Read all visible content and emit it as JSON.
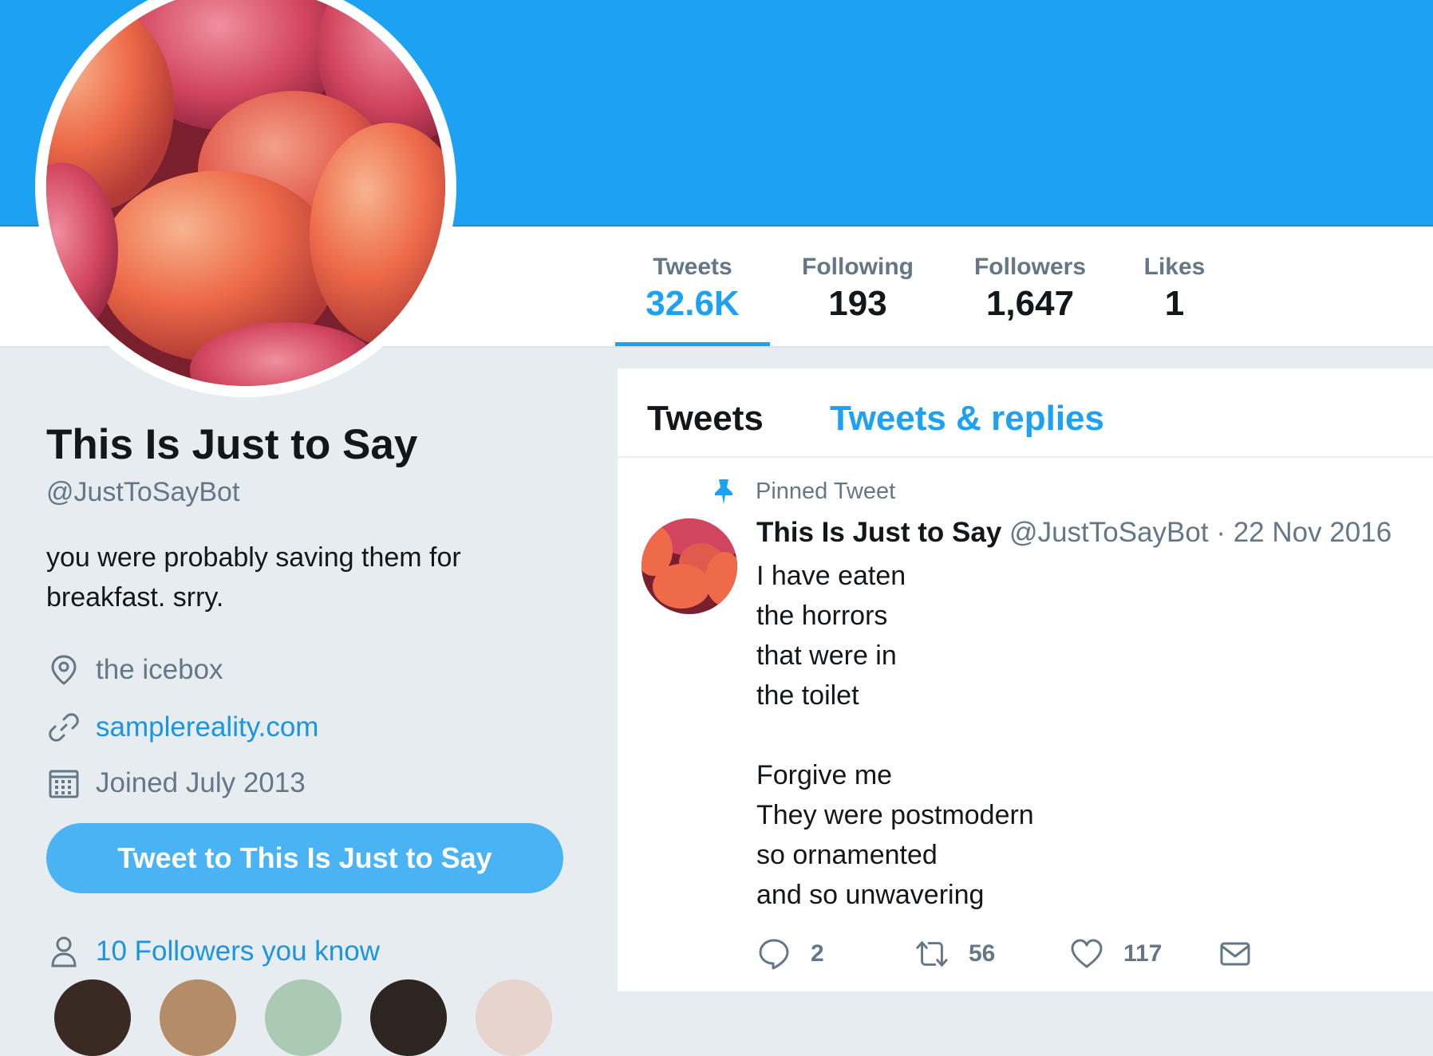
{
  "profile": {
    "name": "This Is Just to Say",
    "handle": "@JustToSayBot",
    "bio": "you were probably saving them for breakfast. srry.",
    "location": "the icebox",
    "website": "samplereality.com",
    "joined": "Joined July 2013",
    "tweet_button": "Tweet to This Is Just to Say",
    "followers_you_know": "10 Followers you know"
  },
  "stats": [
    {
      "label": "Tweets",
      "value": "32.6K"
    },
    {
      "label": "Following",
      "value": "193"
    },
    {
      "label": "Followers",
      "value": "1,647"
    },
    {
      "label": "Likes",
      "value": "1"
    }
  ],
  "timeline": {
    "tabs": [
      "Tweets",
      "Tweets & replies"
    ],
    "pinned_label": "Pinned Tweet",
    "tweet": {
      "author": "This Is Just to Say",
      "handle": "@JustToSayBot",
      "date": "· 22 Nov 2016",
      "lines": [
        "I have eaten",
        "the horrors",
        "that were in",
        "the toilet",
        "",
        "Forgive me",
        "They were postmodern",
        "so ornamented",
        "and so unwavering"
      ],
      "replies": "2",
      "retweets": "56",
      "likes": "117"
    }
  },
  "colors": {
    "accent": "#1da1f2",
    "link": "#1b95e0",
    "muted": "#657786",
    "background": "#e6ecf0"
  }
}
